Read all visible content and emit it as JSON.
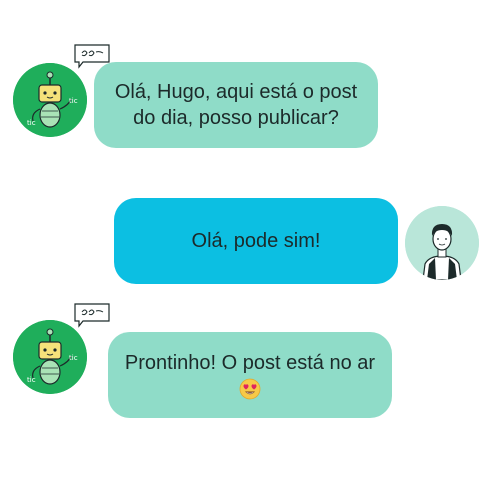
{
  "messages": [
    {
      "sender": "bot",
      "text": "Olá, Hugo, aqui está o post do dia, posso publicar?",
      "avatar_icon": "robot-icon",
      "doodle_icon": "speech-bubble-doodle-icon"
    },
    {
      "sender": "user",
      "text": "Olá, pode sim!",
      "avatar_icon": "man-avatar-icon"
    },
    {
      "sender": "bot",
      "text": "Prontinho! O post está no ar",
      "emoji_icon": "heart-eyes-emoji-icon",
      "avatar_icon": "robot-icon",
      "doodle_icon": "speech-bubble-doodle-icon"
    }
  ],
  "colors": {
    "bot_bubble": "#8fdcc8",
    "user_bubble": "#0cbfe2",
    "bot_avatar_bg": "#1fae5b",
    "user_avatar_bg": "#b9e6d9"
  }
}
